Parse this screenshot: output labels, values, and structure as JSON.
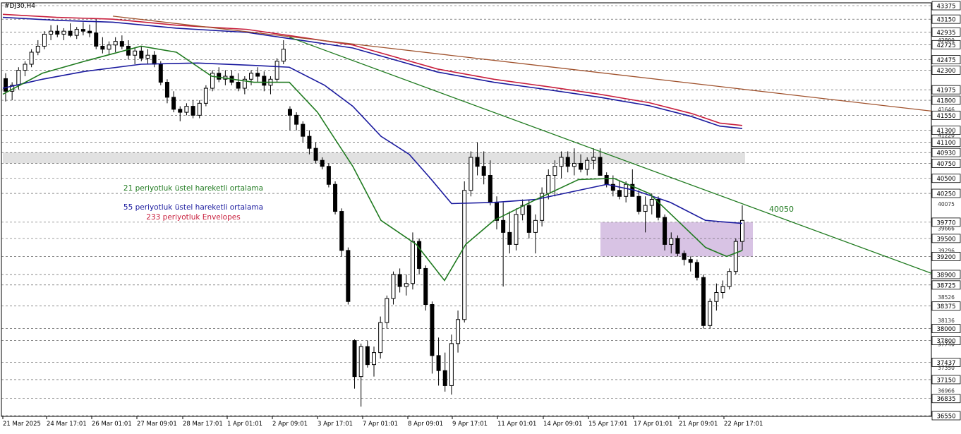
{
  "symbol_title": "#DJ30,H4",
  "chart_data": {
    "type": "candlestick",
    "title": "#DJ30,H4",
    "ylim": [
      36550,
      43375
    ],
    "grid": true,
    "x_tick_labels": [
      "21 Mar 2025",
      "24 Mar 17:01",
      "26 Mar 01:01",
      "27 Mar 09:01",
      "28 Mar 17:01",
      "1 Apr 01:01",
      "2 Apr 09:01",
      "3 Apr 17:01",
      "7 Apr 01:01",
      "8 Apr 09:01",
      "9 Apr 17:01",
      "11 Apr 01:01",
      "14 Apr 09:01",
      "15 Apr 17:01",
      "17 Apr 01:01",
      "21 Apr 09:01",
      "22 Apr 17:01"
    ],
    "y_gridline_labels": [
      "43375",
      "43150",
      "42935",
      "42725",
      "42475",
      "42300",
      "41975",
      "41800",
      "41550",
      "41300",
      "41100",
      "40930",
      "40750",
      "40500",
      "40250",
      "39770",
      "39500",
      "39200",
      "38900",
      "38725",
      "38375",
      "38000",
      "37800",
      "37437",
      "37150",
      "36835",
      "36550"
    ],
    "y_minor_labels": [
      "42800",
      "41646",
      "41220",
      "40075",
      "39666",
      "39296",
      "38526",
      "38136",
      "37740",
      "37350",
      "36966"
    ],
    "price_box_labels": [
      "43375",
      "43150",
      "42935",
      "42725",
      "42475",
      "42300",
      "41975",
      "41800",
      "41550",
      "41300",
      "41100",
      "40930",
      "40750",
      "40500",
      "40250",
      "39770",
      "39500",
      "39200",
      "38900",
      "38725",
      "38375",
      "38000",
      "37800",
      "37437",
      "37150",
      "36835",
      "36550"
    ],
    "candles": [
      [
        42160,
        42250,
        41780,
        41950
      ],
      [
        41950,
        42100,
        41800,
        42050
      ],
      [
        42050,
        42350,
        41980,
        42300
      ],
      [
        42300,
        42450,
        42200,
        42400
      ],
      [
        42400,
        42650,
        42350,
        42600
      ],
      [
        42600,
        42800,
        42550,
        42700
      ],
      [
        42700,
        42950,
        42650,
        42900
      ],
      [
        42900,
        43050,
        42800,
        42950
      ],
      [
        42950,
        43050,
        42850,
        42900
      ],
      [
        42900,
        43000,
        42800,
        42950
      ],
      [
        42950,
        43080,
        42850,
        42880
      ],
      [
        42880,
        43020,
        42820,
        42980
      ],
      [
        42980,
        43100,
        42880,
        42950
      ],
      [
        42950,
        43060,
        42850,
        42920
      ],
      [
        42920,
        43150,
        42650,
        42700
      ],
      [
        42700,
        42850,
        42580,
        42650
      ],
      [
        42650,
        42780,
        42550,
        42720
      ],
      [
        42720,
        42850,
        42600,
        42780
      ],
      [
        42780,
        42880,
        42650,
        42700
      ],
      [
        42700,
        42800,
        42480,
        42550
      ],
      [
        42550,
        42680,
        42400,
        42620
      ],
      [
        42620,
        42700,
        42450,
        42500
      ],
      [
        42500,
        42650,
        42400,
        42550
      ],
      [
        42550,
        42620,
        42350,
        42400
      ],
      [
        42400,
        42450,
        42050,
        42100
      ],
      [
        42100,
        42150,
        41750,
        41850
      ],
      [
        41850,
        41950,
        41600,
        41650
      ],
      [
        41650,
        41700,
        41450,
        41600
      ],
      [
        41600,
        41750,
        41550,
        41700
      ],
      [
        41700,
        41800,
        41500,
        41550
      ],
      [
        41550,
        41800,
        41500,
        41750
      ],
      [
        41750,
        42050,
        41700,
        42000
      ],
      [
        42000,
        42300,
        41950,
        42250
      ],
      [
        42250,
        42350,
        42100,
        42150
      ],
      [
        42150,
        42300,
        42050,
        42200
      ],
      [
        42200,
        42300,
        42050,
        42100
      ],
      [
        42100,
        42250,
        41950,
        42000
      ],
      [
        42000,
        42200,
        41900,
        42150
      ],
      [
        42150,
        42300,
        42050,
        42250
      ],
      [
        42250,
        42350,
        42100,
        42200
      ],
      [
        42200,
        42280,
        41950,
        42050
      ],
      [
        42050,
        42200,
        41900,
        42150
      ],
      [
        42150,
        42500,
        42100,
        42450
      ],
      [
        42450,
        42800,
        42400,
        42650
      ],
      [
        41650,
        41700,
        41300,
        41550
      ],
      [
        41550,
        41600,
        41300,
        41400
      ],
      [
        41400,
        41450,
        41100,
        41200
      ],
      [
        41200,
        41300,
        40900,
        41000
      ],
      [
        41000,
        41100,
        40750,
        40800
      ],
      [
        40800,
        40850,
        40650,
        40700
      ],
      [
        40700,
        40750,
        40350,
        40400
      ],
      [
        40400,
        40450,
        39900,
        39950
      ],
      [
        39950,
        40000,
        39200,
        39300
      ],
      [
        39300,
        39350,
        38400,
        38450
      ],
      [
        37800,
        37820,
        37000,
        37200
      ],
      [
        37200,
        37750,
        36700,
        37700
      ],
      [
        37700,
        37800,
        37350,
        37400
      ],
      [
        37400,
        37700,
        37200,
        37600
      ],
      [
        37600,
        38200,
        37500,
        38100
      ],
      [
        38100,
        38550,
        38000,
        38500
      ],
      [
        38500,
        38950,
        38400,
        38900
      ],
      [
        38900,
        39000,
        38600,
        38700
      ],
      [
        38700,
        38900,
        38550,
        38750
      ],
      [
        38750,
        39600,
        38650,
        39450
      ],
      [
        39450,
        39500,
        38900,
        39000
      ],
      [
        39000,
        39050,
        38300,
        38400
      ],
      [
        38400,
        38450,
        37250,
        37550
      ],
      [
        37550,
        37850,
        37050,
        37300
      ],
      [
        37300,
        37600,
        36950,
        37050
      ],
      [
        37050,
        37900,
        36900,
        37750
      ],
      [
        37750,
        38300,
        37600,
        38150
      ],
      [
        38150,
        40450,
        38100,
        40300
      ],
      [
        40300,
        40950,
        40200,
        40850
      ],
      [
        40850,
        41100,
        40550,
        40700
      ],
      [
        40700,
        40950,
        40400,
        40550
      ],
      [
        40550,
        40800,
        40050,
        40100
      ],
      [
        40100,
        40200,
        39650,
        39800
      ],
      [
        39800,
        40100,
        38700,
        39600
      ],
      [
        39600,
        39950,
        39250,
        39400
      ],
      [
        39400,
        40000,
        39300,
        39900
      ],
      [
        39900,
        40150,
        39800,
        40050
      ],
      [
        40050,
        40150,
        39500,
        39600
      ],
      [
        39600,
        39900,
        39250,
        39800
      ],
      [
        39800,
        40350,
        39700,
        40250
      ],
      [
        40250,
        40650,
        40150,
        40550
      ],
      [
        40550,
        40800,
        40200,
        40700
      ],
      [
        40700,
        40950,
        40500,
        40850
      ],
      [
        40850,
        40950,
        40600,
        40700
      ],
      [
        40700,
        41000,
        40550,
        40750
      ],
      [
        40750,
        40900,
        40600,
        40650
      ],
      [
        40650,
        40850,
        40550,
        40800
      ],
      [
        40800,
        41000,
        40650,
        40850
      ],
      [
        40850,
        41000,
        40700,
        40550
      ],
      [
        40550,
        40600,
        40350,
        40400
      ],
      [
        40400,
        40550,
        40200,
        40300
      ],
      [
        40300,
        40450,
        40150,
        40200
      ],
      [
        40200,
        40450,
        40100,
        40400
      ],
      [
        40400,
        40650,
        40350,
        40200
      ],
      [
        40200,
        40300,
        39900,
        39950
      ],
      [
        39950,
        40200,
        39600,
        40050
      ],
      [
        40050,
        40250,
        39900,
        40150
      ],
      [
        40150,
        40200,
        39800,
        39850
      ],
      [
        39850,
        39900,
        39300,
        39400
      ],
      [
        39400,
        39600,
        39250,
        39500
      ],
      [
        39500,
        39550,
        39200,
        39250
      ],
      [
        39250,
        39300,
        39050,
        39150
      ],
      [
        39150,
        39200,
        38950,
        39100
      ],
      [
        39100,
        39150,
        38800,
        38850
      ],
      [
        38850,
        38900,
        38000,
        38050
      ],
      [
        38050,
        38500,
        38000,
        38450
      ],
      [
        38450,
        38750,
        38300,
        38600
      ],
      [
        38600,
        38800,
        38500,
        38700
      ],
      [
        38700,
        39000,
        38650,
        38950
      ],
      [
        38950,
        39500,
        38900,
        39450
      ],
      [
        39450,
        40050,
        39300,
        39800
      ]
    ],
    "series": [
      {
        "name": "21 periyotluk üstel hareketli ortalama",
        "color": "#1f7a1f"
      },
      {
        "name": "55 periyotluk üstel hareketli ortalama",
        "color": "#1a1a9e"
      },
      {
        "name": "233 periyotluk Envelopes",
        "color": "#c81e3c"
      }
    ],
    "trendline_label": "40050",
    "annotations": [
      {
        "text": "21 periyotluk üstel hareketli ortalama",
        "color": "#1f7a1f"
      },
      {
        "text": "55 periyotluk üstel hareketli ortalama",
        "color": "#1a1a9e"
      },
      {
        "text": "233 periyotluk Envelopes",
        "color": "#c81e3c"
      }
    ]
  }
}
